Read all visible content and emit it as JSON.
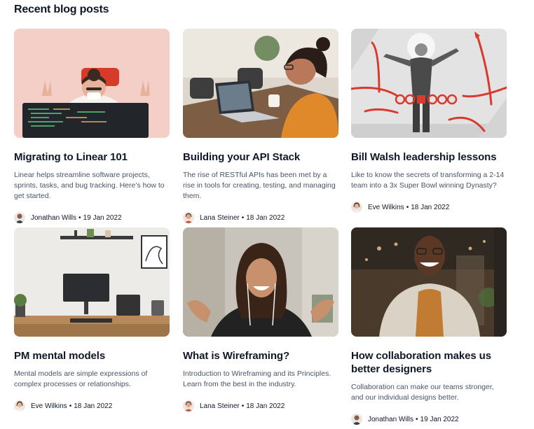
{
  "section": {
    "title": "Recent blog posts"
  },
  "posts": [
    {
      "title": "Migrating to Linear 101",
      "excerpt": "Linear helps streamline software projects, sprints, tasks, and bug tracking. Here’s how to get started.",
      "author": "Jonathan Wills",
      "date": "19 Jan 2022",
      "image": "woman-at-laptop-masked"
    },
    {
      "title": "Building your API Stack",
      "excerpt": "The rise of RESTful APIs has been met by a rise in tools for creating, testing, and managing them.",
      "author": "Lana Steiner",
      "date": "18 Jan 2022",
      "image": "woman-video-call"
    },
    {
      "title": "Bill Walsh leadership lessons",
      "excerpt": "Like to know the secrets of transforming a 2-14 team into a 3x Super Bowl winning Dynasty?",
      "author": "Eve Wilkins",
      "date": "18 Jan 2022",
      "image": "coach-playbook-illustration"
    },
    {
      "title": "PM mental models",
      "excerpt": "Mental models are simple expressions of complex processes or relationships.",
      "author": "Eve Wilkins",
      "date": "18 Jan 2022",
      "image": "desk-setup"
    },
    {
      "title": "What is Wireframing?",
      "excerpt": "Introduction to Wireframing and its Principles. Learn from the best in the industry.",
      "author": "Lana Steiner",
      "date": "18 Jan 2022",
      "image": "woman-headphones"
    },
    {
      "title": "How collaboration makes us better designers",
      "excerpt": "Collaboration can make our teams stronger, and our individual designs better.",
      "author": "Jonathan Wills",
      "date": "19 Jan 2022",
      "image": "man-smiling"
    }
  ],
  "meta_separator": "•"
}
